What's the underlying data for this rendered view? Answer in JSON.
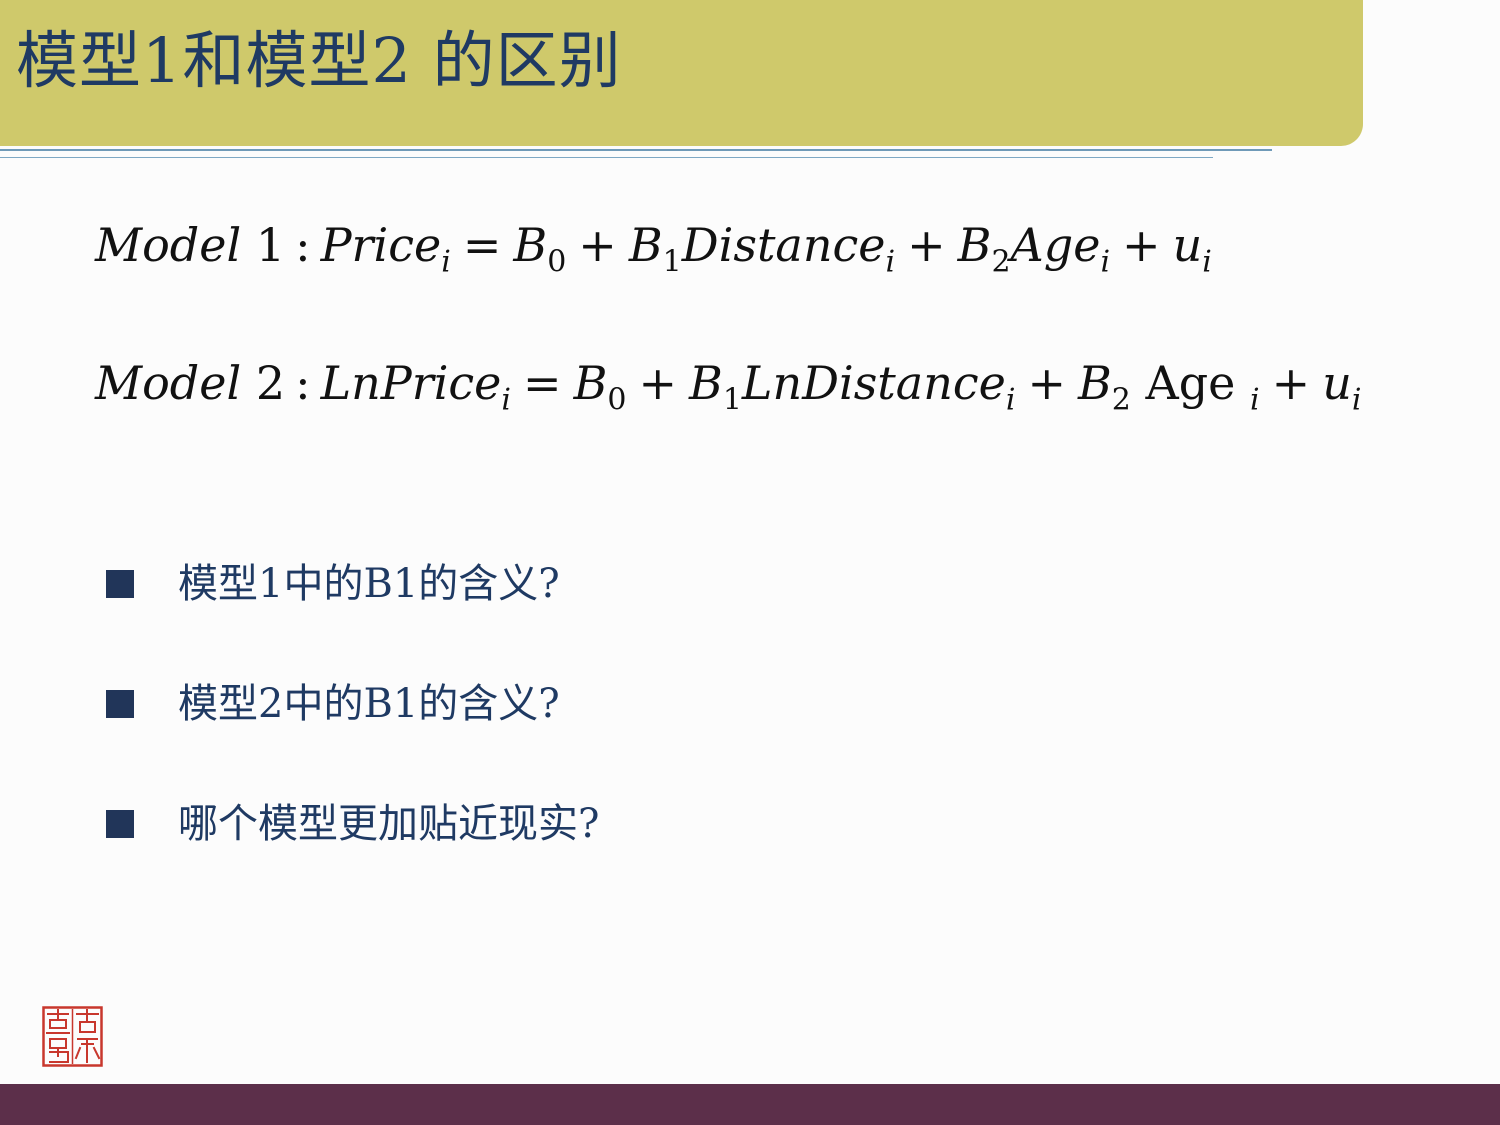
{
  "slide": {
    "title": "模型1和模型2 的区别"
  },
  "equations": {
    "model1": {
      "label": "Model",
      "number": "1",
      "colon": ":",
      "lhs": "Price",
      "lhs_sub": "i",
      "equals": "=",
      "b0": "B",
      "b0_sub": "0",
      "plus1": "+",
      "b1": "B",
      "b1_sub": "1",
      "var1": "Distance",
      "var1_sub": "i",
      "plus2": "+",
      "b2": "B",
      "b2_sub": "2",
      "var2": "Age",
      "var2_sub": "i",
      "plus3": "+",
      "err": "u",
      "err_sub": "i"
    },
    "model2": {
      "label": "Model",
      "number": "2",
      "colon": ":",
      "lhs": "LnPrice",
      "lhs_sub": "i",
      "equals": "=",
      "b0": "B",
      "b0_sub": "0",
      "plus1": "+",
      "b1": "B",
      "b1_sub": "1",
      "var1": "LnDistance",
      "var1_sub": "i",
      "plus2": "+",
      "b2": "B",
      "b2_sub": "2",
      "var2": "Age",
      "var2_sub": "i",
      "plus3": "+",
      "err": "u",
      "err_sub": "i"
    }
  },
  "questions": [
    "模型1中的B1的含义?",
    "模型2中的B1的含义?",
    "哪个模型更加贴近现实?"
  ],
  "colors": {
    "title_bar": "#cfc96b",
    "title_text": "#1f3a63",
    "bullet": "#213559",
    "footer_bar": "#5c2f4a",
    "seal": "#c8372d"
  },
  "icons": {
    "bullet": "square-bullet-icon",
    "seal": "seal-stamp-icon"
  }
}
